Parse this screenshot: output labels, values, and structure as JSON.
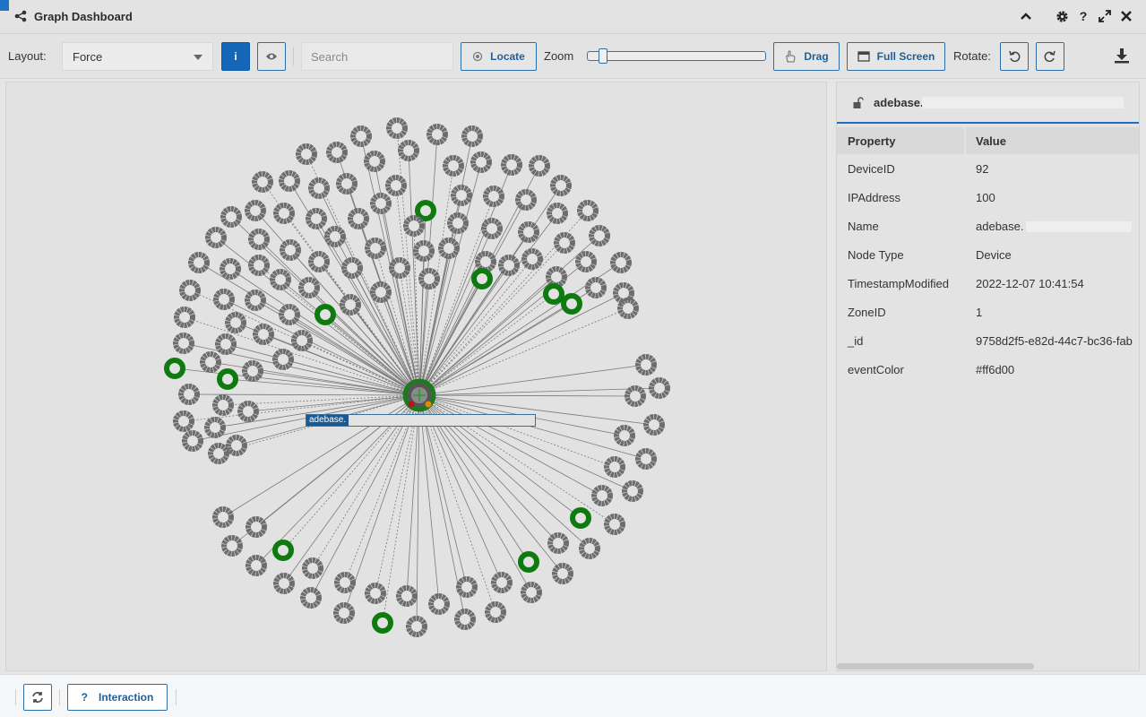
{
  "window": {
    "title": "Graph Dashboard",
    "icons": [
      "share-icon",
      "chevron-up-icon",
      "gear-icon",
      "help-icon",
      "expand-icon",
      "close-icon"
    ]
  },
  "toolbar": {
    "layout_label": "Layout:",
    "layout_value": "Force",
    "info_label": "i",
    "search_placeholder": "Search",
    "locate_label": "Locate",
    "zoom_label": "Zoom",
    "zoom_level": 0.06,
    "drag_label": "Drag",
    "fullscreen_label": "Full Screen",
    "rotate_label": "Rotate:"
  },
  "graph": {
    "center_label": "adebase.",
    "center_color": "#1f7a1f",
    "colors": {
      "node_default": "#6d6d6d",
      "node_highlight": "#0f7a0f",
      "edge": "#7a7a7a"
    }
  },
  "details": {
    "title": "adebase.",
    "columns": [
      "Property",
      "Value"
    ],
    "rows": [
      {
        "key": "DeviceID",
        "value": "92"
      },
      {
        "key": "IPAddress",
        "value": "100"
      },
      {
        "key": "Name",
        "value": "adebase."
      },
      {
        "key": "Node Type",
        "value": "Device"
      },
      {
        "key": "TimestampModified",
        "value": "2022-12-07 10:41:54"
      },
      {
        "key": "ZoneID",
        "value": "1"
      },
      {
        "key": "_id",
        "value": "9758d2f5-e82d-44c7-bc36-fab"
      },
      {
        "key": "eventColor",
        "value": "#ff6d00"
      }
    ]
  },
  "bottombar": {
    "interaction_label": "Interaction",
    "help_glyph": "?"
  }
}
